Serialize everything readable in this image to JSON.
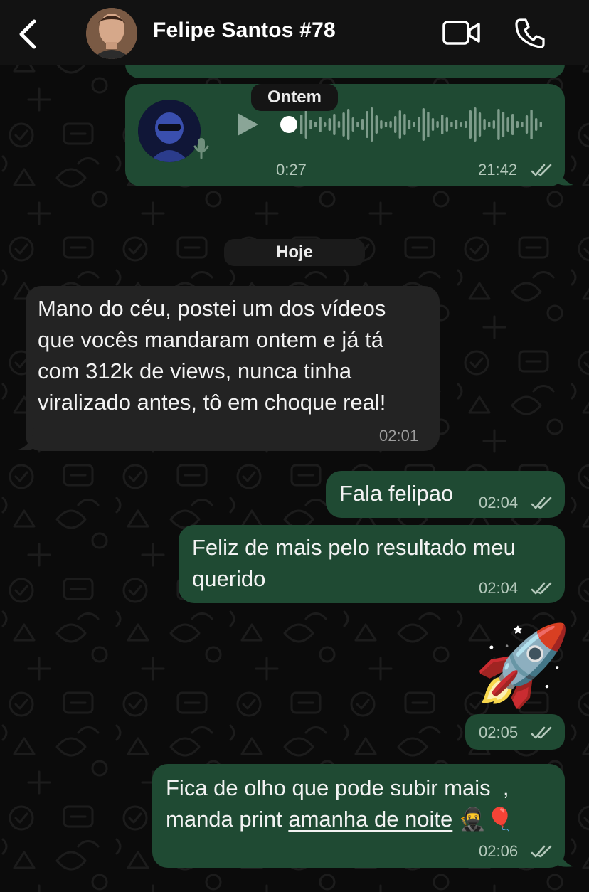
{
  "header": {
    "contact_name": "Felipe Santos #78"
  },
  "voice_message": {
    "duration": "0:27",
    "time": "21:42"
  },
  "date_labels": {
    "yesterday": "Ontem",
    "today": "Hoje"
  },
  "messages": [
    {
      "direction": "incoming",
      "text_lines": [
        "Mano do céu, postei um dos vídeos",
        "que vocês mandaram ontem e já tá",
        "com 312k de views, nunca tinha",
        "viralizado antes, tô em choque real!"
      ],
      "time": "02:01"
    },
    {
      "direction": "outgoing",
      "text": "Fala felipao",
      "time": "02:04"
    },
    {
      "direction": "outgoing",
      "text_lines": [
        "Feliz de mais pelo resultado meu",
        "querido"
      ],
      "time": "02:04"
    },
    {
      "direction": "outgoing",
      "emoji": "🚀",
      "time": "02:05"
    },
    {
      "direction": "outgoing",
      "line1": "Fica de olho que pode subir mais  ,",
      "line2_prefix": "manda print ",
      "line2_link": "amanha de noite",
      "line2_emoji": " 🥷🎈",
      "time": "02:06"
    }
  ],
  "colors": {
    "outgoing_bubble": "#1f4a33",
    "incoming_bubble": "#232323",
    "header_bg": "#121212",
    "background": "#0b0b0b"
  },
  "icons": [
    "back-chevron-icon",
    "video-call-icon",
    "phone-call-icon",
    "play-icon",
    "microphone-icon",
    "double-check-icon"
  ]
}
